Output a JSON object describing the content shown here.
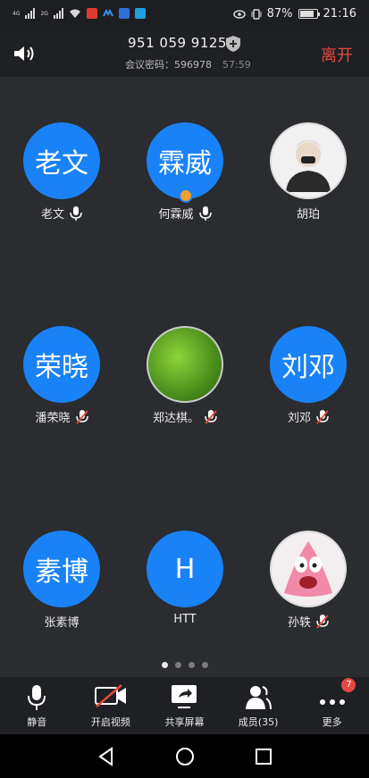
{
  "status_bar": {
    "sim1": "4G",
    "sim2": "2G",
    "battery": "87%",
    "battery_level": 0.87,
    "time": "21:16"
  },
  "header": {
    "meeting_id": "951 059 9125",
    "password_label": "会议密码：596978",
    "timer": "57:59",
    "leave_label": "离开"
  },
  "participants": [
    {
      "avatar_text": "老文",
      "name": "老文",
      "mic": "on",
      "avatar": "text"
    },
    {
      "avatar_text": "霖威",
      "name": "何霖威",
      "mic": "on",
      "avatar": "text",
      "host": true
    },
    {
      "avatar_text": "",
      "name": "胡珀",
      "mic": "none",
      "avatar": "photo"
    },
    {
      "avatar_text": "荣晓",
      "name": "潘荣晓",
      "mic": "muted",
      "avatar": "text"
    },
    {
      "avatar_text": "",
      "name": "郑达棋。",
      "mic": "muted",
      "avatar": "grass"
    },
    {
      "avatar_text": "刘邓",
      "name": "刘邓",
      "mic": "muted",
      "avatar": "text"
    },
    {
      "avatar_text": "素博",
      "name": "张素博",
      "mic": "none",
      "avatar": "text"
    },
    {
      "avatar_text": "H",
      "name": "HTT",
      "mic": "none",
      "avatar": "text"
    },
    {
      "avatar_text": "",
      "name": "孙轶",
      "mic": "muted",
      "avatar": "pink"
    }
  ],
  "pager": {
    "pages": 4,
    "current": 1
  },
  "toolbar": {
    "mute": "静音",
    "video": "开启视频",
    "share": "共享屏幕",
    "members": "成员(35)",
    "more": "更多",
    "more_badge": "7"
  },
  "colors": {
    "accent_blue": "#1a82f7",
    "leave_red": "#e6483e",
    "background": "#2b2c30"
  }
}
